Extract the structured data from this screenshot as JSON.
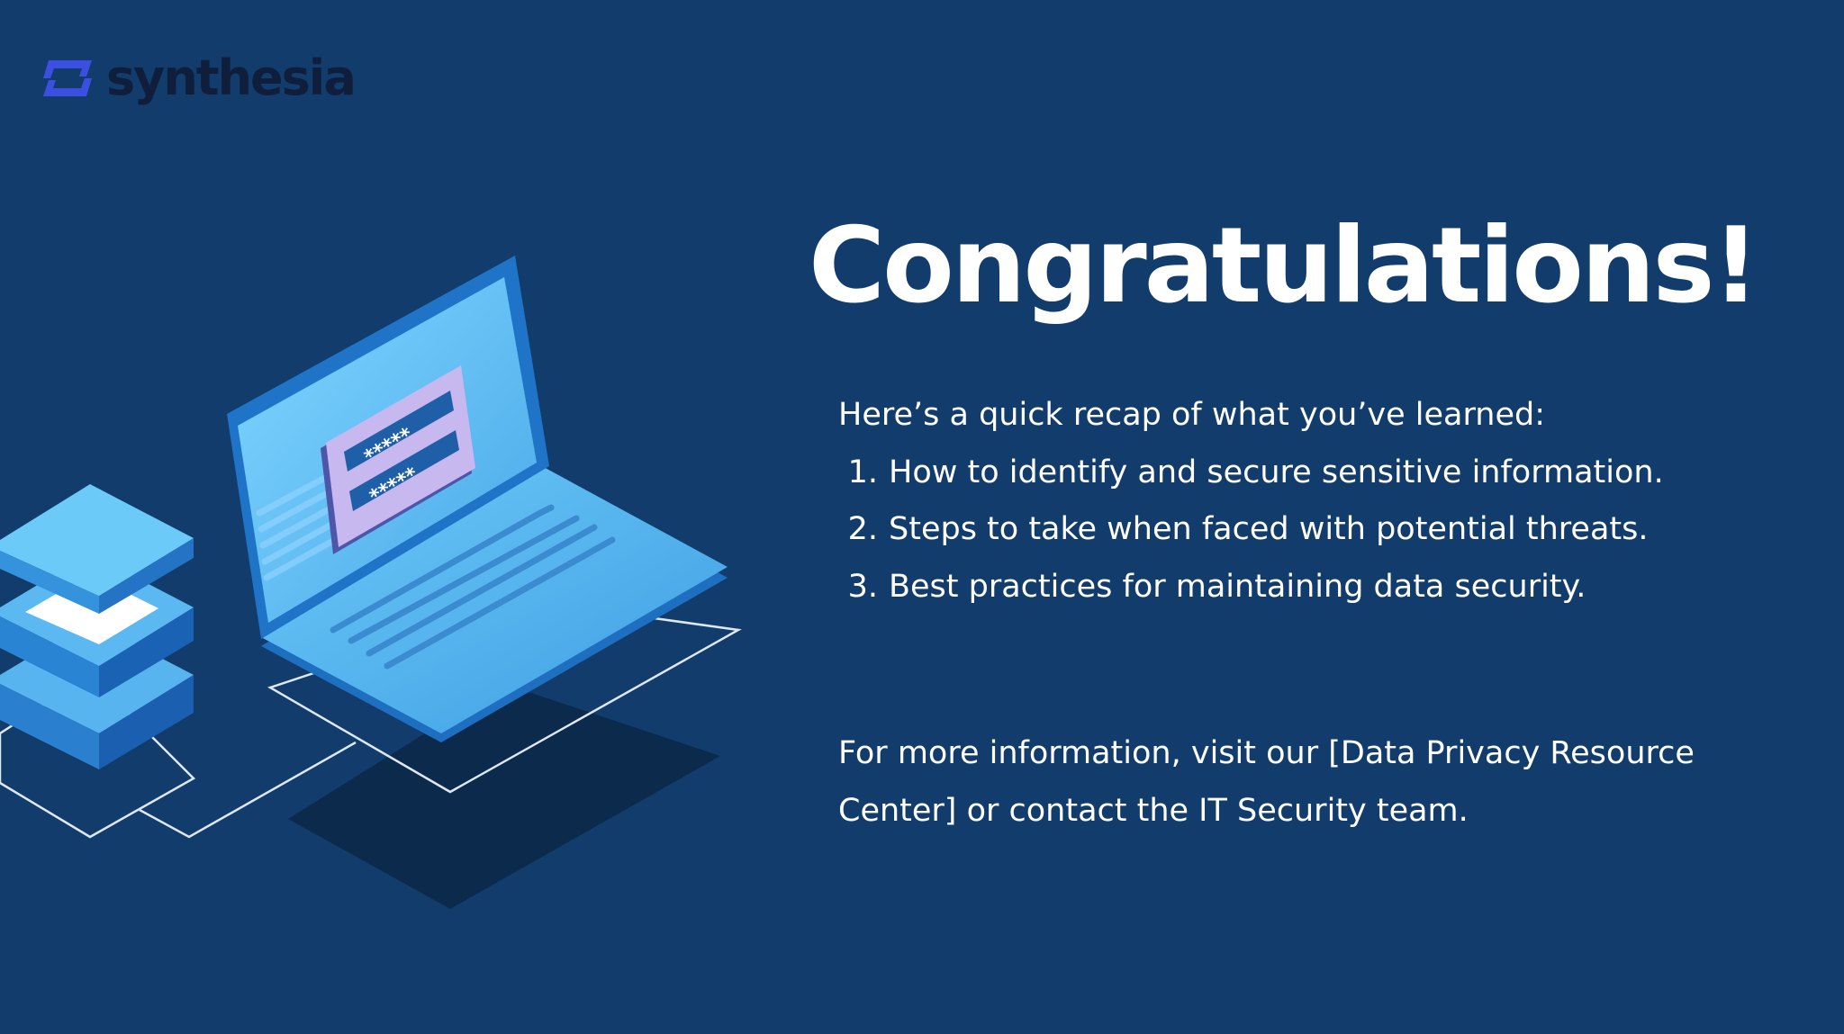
{
  "brand": {
    "name": "synthesia",
    "logo_icon": "synthesia-logo-mark",
    "colors": {
      "background": "#123c6b",
      "logo_mark": "#3b4fe0",
      "logo_text": "#0f1e3a"
    }
  },
  "illustration": {
    "icon": "laptop-password-illustration",
    "password_fields": [
      "*****",
      "*****"
    ]
  },
  "content": {
    "title": "Congratulations!",
    "recap_intro": "Here’s a quick recap of what you’ve learned:",
    "recap_items": [
      {
        "number": "1.",
        "text": "How to identify and secure sensitive information."
      },
      {
        "number": "2.",
        "text": "Steps to take when faced with potential threats."
      },
      {
        "number": "3.",
        "text": "Best practices for maintaining data security."
      }
    ],
    "more_info_line1": "For more information, visit our [Data Privacy Resource",
    "more_info_line2": "Center] or contact the IT Security team."
  }
}
